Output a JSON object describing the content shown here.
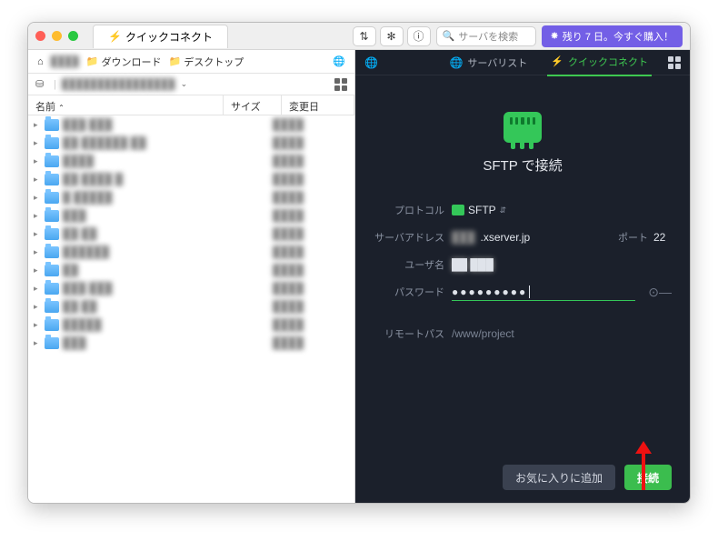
{
  "titlebar": {
    "quick_connect_tab": "クイックコネクト",
    "search_placeholder": "サーバを検索",
    "promo": "残り 7 日。今すぐ購入！"
  },
  "left": {
    "crumbs": {
      "home": "⌂",
      "path1": "████",
      "downloads": "ダウンロード",
      "desktop": "デスクトップ"
    },
    "drive_path": "████████████████",
    "columns": {
      "name": "名前",
      "size": "サイズ",
      "date": "変更日"
    },
    "rows": [
      {
        "name": "███ ███",
        "date": "████"
      },
      {
        "name": "██ ██████ ██",
        "date": "████"
      },
      {
        "name": "████",
        "date": "████"
      },
      {
        "name": "██ ████ █",
        "date": "████"
      },
      {
        "name": "█ █████",
        "date": "████"
      },
      {
        "name": "███",
        "date": "████"
      },
      {
        "name": "██ ██",
        "date": "████"
      },
      {
        "name": "██████",
        "date": "████"
      },
      {
        "name": "██",
        "date": "████"
      },
      {
        "name": "███ ███",
        "date": "████"
      },
      {
        "name": "██ ██",
        "date": "████"
      },
      {
        "name": "█████",
        "date": "████"
      },
      {
        "name": "███",
        "date": "████"
      }
    ]
  },
  "right": {
    "tab_servers": "サーバリスト",
    "tab_quick": "クイックコネクト",
    "title": "SFTP で接続",
    "labels": {
      "protocol": "プロトコル",
      "server": "サーバアドレス",
      "port": "ポート",
      "user": "ユーザ名",
      "password": "パスワード",
      "remote": "リモートパス"
    },
    "values": {
      "protocol": "SFTP",
      "server": "███.xserver.jp",
      "port": "22",
      "user": "██ ███",
      "password_mask": "●●●●●●●●●",
      "remote": "/www/project"
    },
    "buttons": {
      "favorite": "お気に入りに追加",
      "connect": "接続"
    }
  }
}
